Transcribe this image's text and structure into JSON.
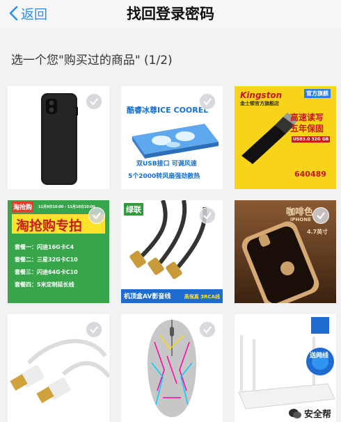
{
  "navbar": {
    "back_label": "返回",
    "title": "找回登录密码"
  },
  "prompt": "选一个您\"购买过的商品\" (1/2)",
  "products": [
    {
      "name": "black-phone-case"
    },
    {
      "name": "laptop-cooler",
      "top": "酷睿冰尊ICE COOREL",
      "mid": "双USB接口 可调风速",
      "bottom": "5个2000转风扇强劲散热"
    },
    {
      "name": "kingston-usb",
      "brand": "Kingston",
      "brand_sub": "金士顿官方旗舰店",
      "badge": "官方旗舰",
      "slogan1": "高速读写",
      "slogan2": "五年保固",
      "model": "USB3.0 32G GB",
      "sku": "640489"
    },
    {
      "name": "sd-card-promo",
      "logo": "淘抢购",
      "date": "11月9日10:00 - 11月10日10:00",
      "title": "淘抢购专拍",
      "options": [
        "套餐一：闪迪16G卡C4",
        "套餐二：三星32G卡C10",
        "套餐三：闪迪64G卡C10",
        "套餐四：5米定制延长线"
      ]
    },
    {
      "name": "av-cable",
      "brand": "绿联",
      "caption": "机顶盒AV影音线",
      "caption_tag": "高保真 3RCA线"
    },
    {
      "name": "gold-phone-case",
      "title": "咖啡色",
      "sub1": "iPHONE",
      "sub2": "4.7英寸"
    },
    {
      "name": "usb-cable"
    },
    {
      "name": "gaming-mouse"
    },
    {
      "name": "wifi-router",
      "sticker": "送网线"
    }
  ],
  "watermark": "安全帮"
}
